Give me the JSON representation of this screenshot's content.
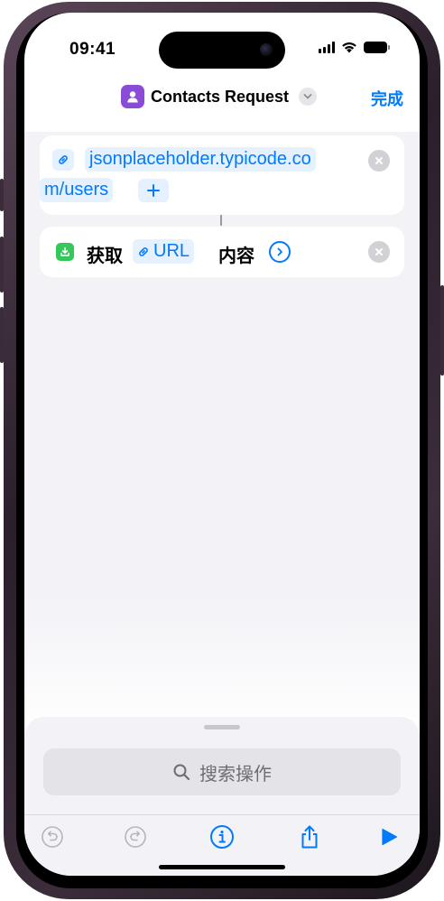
{
  "status_bar": {
    "time": "09:41"
  },
  "nav": {
    "title": "Contacts Request",
    "done_label": "完成"
  },
  "actions": {
    "url": {
      "line1": "jsonplaceholder.typicode.co",
      "line2": "m/users"
    },
    "get": {
      "verb": "获取",
      "token_label": "URL",
      "object": "内容"
    }
  },
  "sheet": {
    "search_placeholder": "搜索操作"
  },
  "colors": {
    "accent": "#007aff",
    "shortcut_icon_bg": "#8a4cd6",
    "get_action_icon_bg": "#34c759",
    "token_bg": "#e5f1ff"
  },
  "icons": {
    "shortcut": "person-icon",
    "url_action": "link-icon",
    "get_action": "download-icon",
    "search": "magnifier-icon",
    "undo": "undo-icon",
    "redo": "redo-icon",
    "info": "info-icon",
    "share": "share-icon",
    "run": "play-icon"
  }
}
